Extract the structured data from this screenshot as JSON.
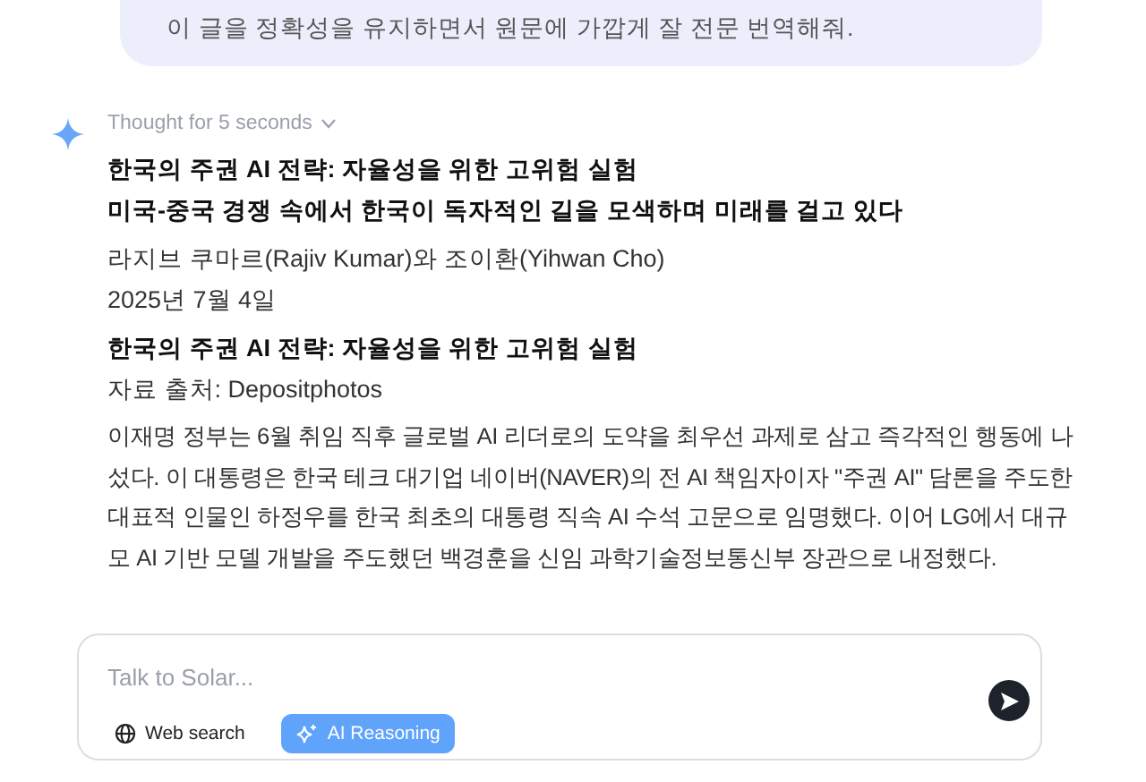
{
  "user_message": {
    "text": "이 글을 정확성을 유지하면서 원문에 가깝게 잘 전문 번역해줘."
  },
  "assistant": {
    "thought": {
      "label": "Thought for 5 seconds",
      "expanded": false
    },
    "blocks": [
      {
        "kind": "heading",
        "text": "한국의 주권 AI 전략: 자율성을 위한 고위험 실험"
      },
      {
        "kind": "heading",
        "text": "미국-중국 경쟁 속에서 한국이 독자적인 길을 모색하며 미래를 걸고 있다"
      },
      {
        "kind": "gap"
      },
      {
        "kind": "meta",
        "text": "라지브 쿠마르(Rajiv Kumar)와 조이환(Yihwan Cho)"
      },
      {
        "kind": "meta",
        "text": "2025년 7월 4일"
      },
      {
        "kind": "gap"
      },
      {
        "kind": "heading",
        "text": "한국의 주권 AI 전략: 자율성을 위한 고위험 실험"
      },
      {
        "kind": "meta",
        "text": "자료 출처: Depositphotos"
      },
      {
        "kind": "gap"
      },
      {
        "kind": "paragraph",
        "text": "이재명 정부는 6월 취임 직후 글로벌 AI 리더로의 도약을 최우선 과제로 삼고 즉각적인 행동에 나섰다. 이 대통령은 한국 테크 대기업 네이버(NAVER)의 전 AI 책임자이자 \"주권 AI\" 담론을 주도한 대표적 인물인 하정우를 한국 최초의 대통령 직속 AI 수석 고문으로 임명했다. 이어 LG에서 대규모 AI 기반 모델 개발을 주도했던 백경훈을 신임 과학기술정보통신부 장관으로 내정했다."
      }
    ]
  },
  "composer": {
    "placeholder": "Talk to Solar...",
    "toggles": [
      {
        "kind": "globe",
        "label": "Web search",
        "selected": false
      },
      {
        "kind": "sparkle",
        "label": "AI Reasoning",
        "selected": true
      }
    ]
  }
}
